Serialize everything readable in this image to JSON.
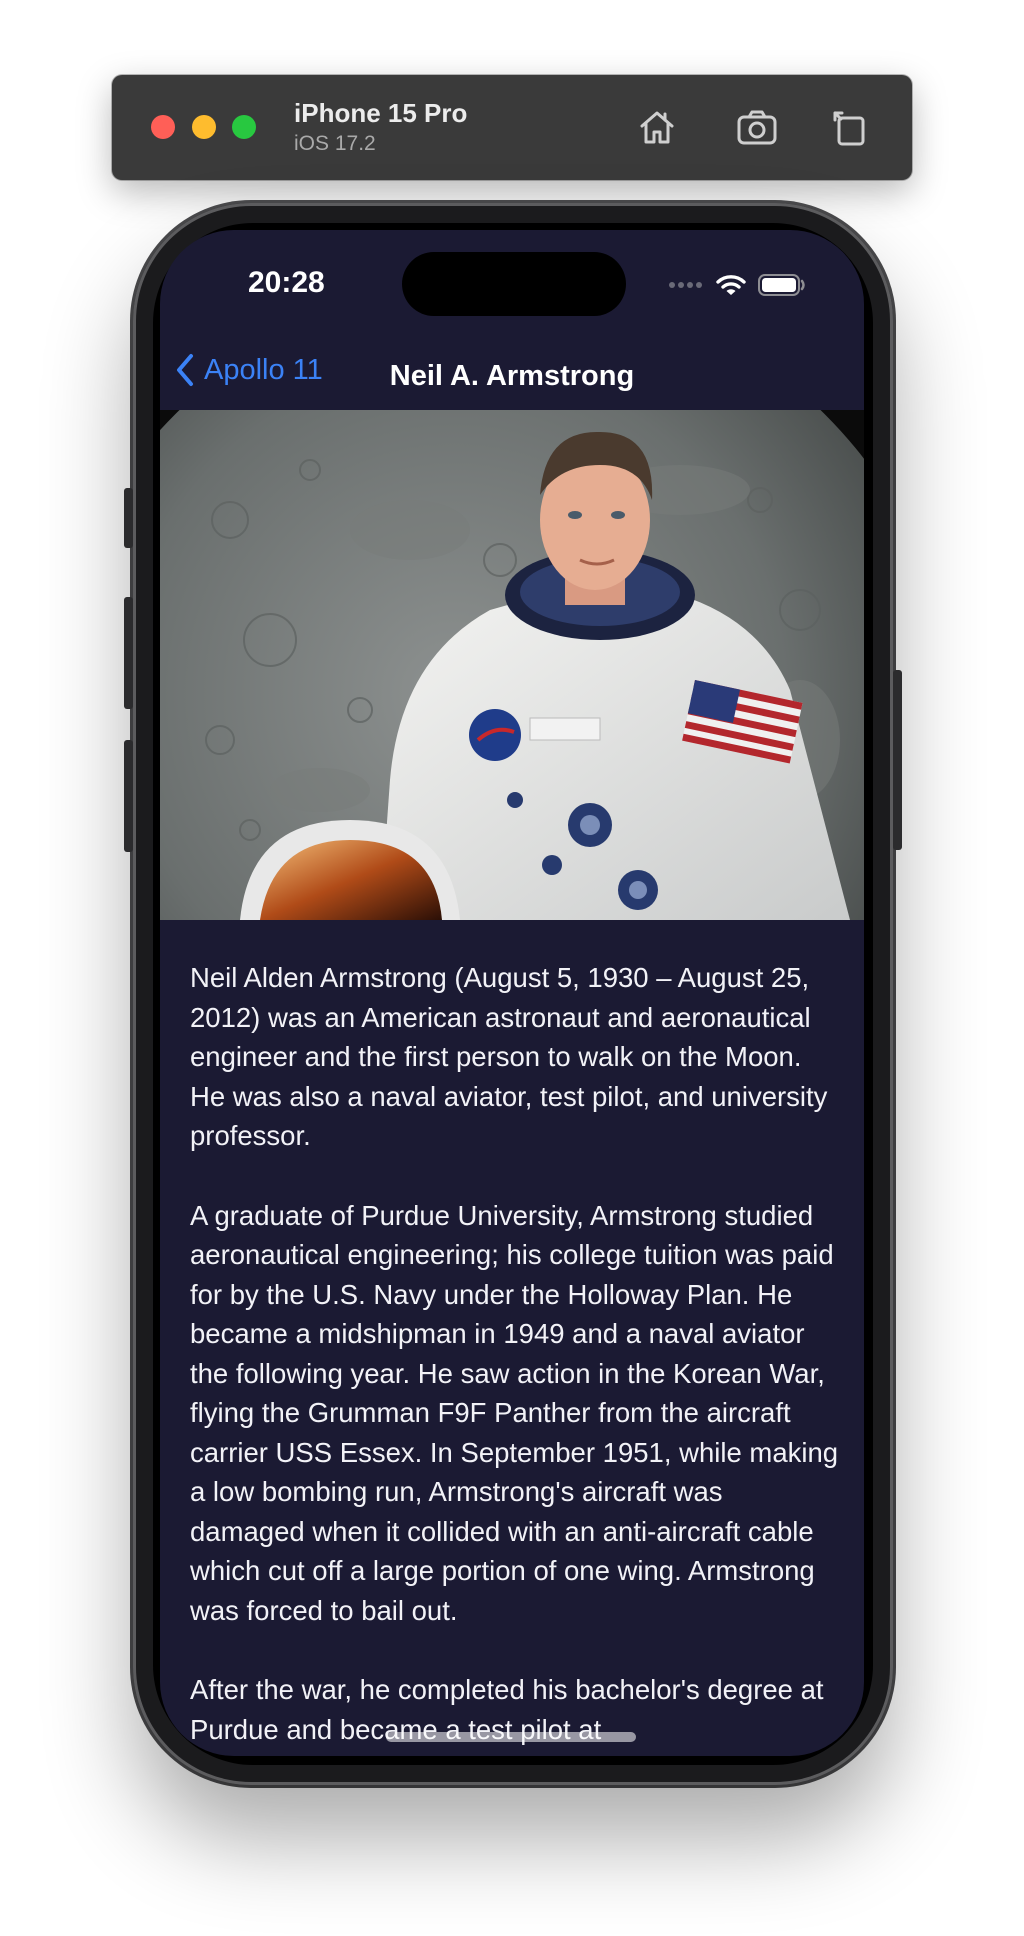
{
  "simulator": {
    "device_name": "iPhone 15 Pro",
    "os_version": "iOS 17.2",
    "toolbar_icons": [
      "home-icon",
      "screenshot-icon",
      "rotate-icon"
    ]
  },
  "status_bar": {
    "time": "20:28",
    "icons": [
      "cellular-signal-icon",
      "wifi-icon",
      "battery-icon"
    ]
  },
  "navigation": {
    "back_label": "Apollo 11",
    "title": "Neil A. Armstrong"
  },
  "hero_image": {
    "subject": "astronaut-portrait"
  },
  "article": {
    "paragraphs": [
      "Neil Alden Armstrong (August 5, 1930 – August 25, 2012) was an American astronaut and aeronautical engineer and the first person to walk on the Moon. He was also a naval aviator, test pilot, and university professor.",
      "A graduate of Purdue University, Armstrong studied aeronautical engineering; his college tuition was paid for by the U.S. Navy under the Holloway Plan. He became a midshipman in 1949 and a naval aviator the following year. He saw action in the Korean War, flying the Grumman F9F Panther from the aircraft carrier USS Essex. In September 1951, while making a low bombing run, Armstrong's aircraft was damaged when it collided with an anti-aircraft cable which cut off a large portion of one wing. Armstrong was forced to bail out.",
      "After the war, he completed his bachelor's degree at Purdue and became a test pilot at"
    ]
  },
  "colors": {
    "screen_background": "#1b1a33",
    "accent": "#3b82f6",
    "text": "#f2f2f7"
  }
}
